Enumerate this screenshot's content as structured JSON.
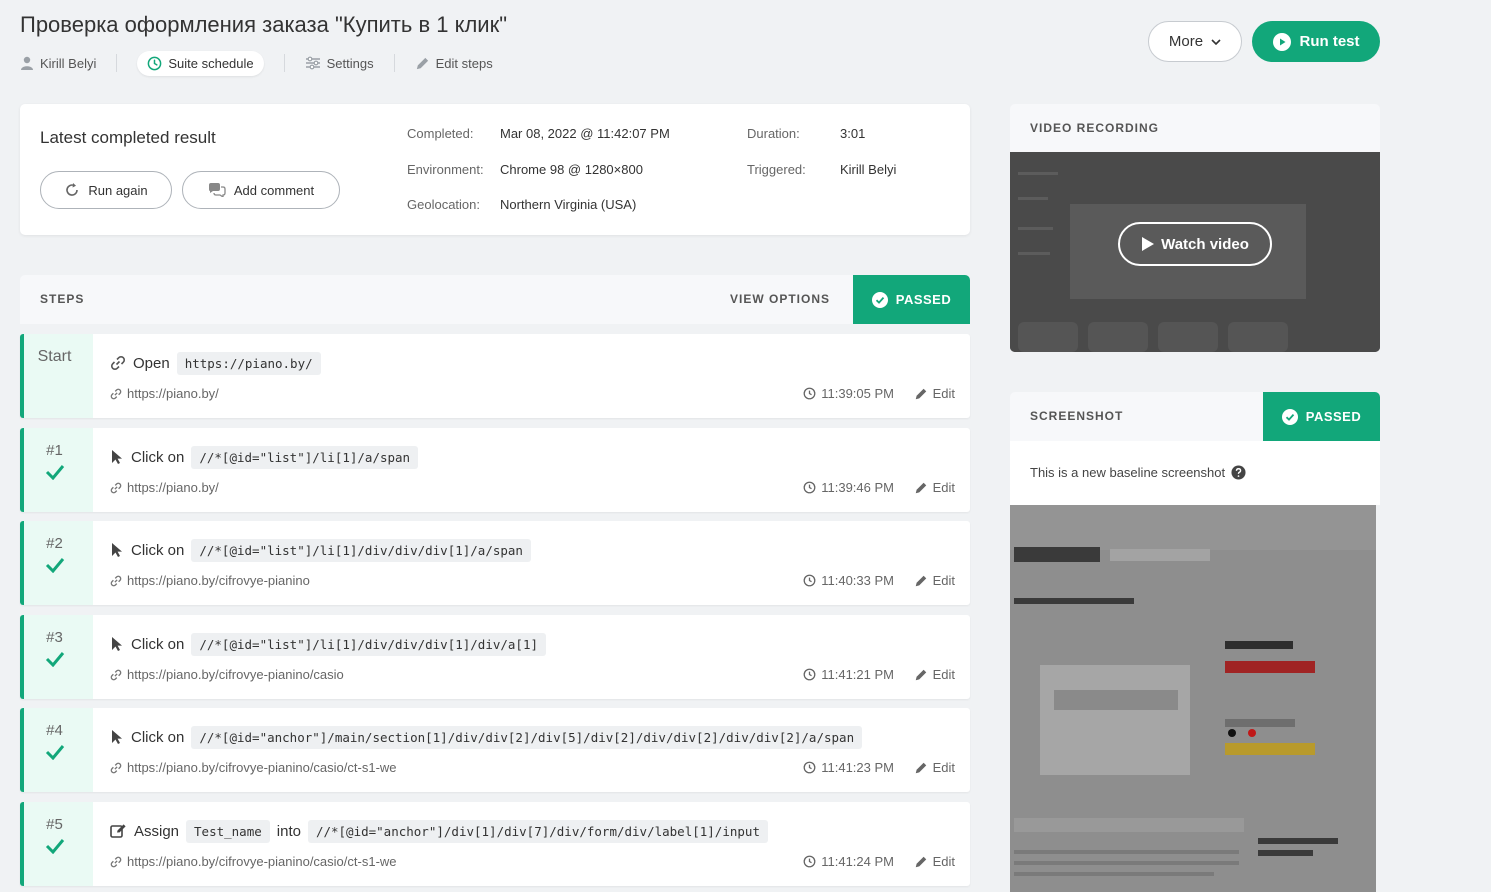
{
  "header": {
    "title": "Проверка оформления заказа \"Купить в 1 клик\"",
    "user": "Kirill Belyi",
    "suite_schedule": "Suite schedule",
    "settings": "Settings",
    "edit_steps": "Edit steps",
    "more": "More",
    "run_test": "Run test"
  },
  "latest": {
    "title": "Latest completed result",
    "run_again": "Run again",
    "add_comment": "Add comment",
    "completed_label": "Completed:",
    "completed_value": "Mar 08, 2022 @ 11:42:07 PM",
    "environment_label": "Environment:",
    "environment_value": "Chrome 98 @ 1280×800",
    "geolocation_label": "Geolocation:",
    "geolocation_value": "Northern Virginia (USA)",
    "duration_label": "Duration:",
    "duration_value": "3:01",
    "triggered_label": "Triggered:",
    "triggered_value": "Kirill Belyi"
  },
  "steps_panel": {
    "label": "STEPS",
    "view_options": "VIEW OPTIONS",
    "status": "PASSED"
  },
  "steps": [
    {
      "num": "Start",
      "action": "Open",
      "selector": "https://piano.by/",
      "url": "https://piano.by/",
      "time": "11:39:05 PM",
      "edit": "Edit"
    },
    {
      "num": "#1",
      "action": "Click on",
      "selector": "//*[@id=\"list\"]/li[1]/a/span",
      "url": "https://piano.by/",
      "time": "11:39:46 PM",
      "edit": "Edit"
    },
    {
      "num": "#2",
      "action": "Click on",
      "selector": "//*[@id=\"list\"]/li[1]/div/div/div[1]/a/span",
      "url": "https://piano.by/cifrovye-pianino",
      "time": "11:40:33 PM",
      "edit": "Edit"
    },
    {
      "num": "#3",
      "action": "Click on",
      "selector": "//*[@id=\"list\"]/li[1]/div/div/div[1]/div/a[1]",
      "url": "https://piano.by/cifrovye-pianino/casio",
      "time": "11:41:21 PM",
      "edit": "Edit"
    },
    {
      "num": "#4",
      "action": "Click on",
      "selector": "//*[@id=\"anchor\"]/main/section[1]/div/div[2]/div[5]/div[2]/div/div[2]/div/div[2]/a/span",
      "url": "https://piano.by/cifrovye-pianino/casio/ct-s1-we",
      "time": "11:41:23 PM",
      "edit": "Edit"
    },
    {
      "num": "#5",
      "action": "Assign",
      "value": "Test_name",
      "into": "into",
      "selector": "//*[@id=\"anchor\"]/div[1]/div[7]/div/form/div/label[1]/input",
      "url": "https://piano.by/cifrovye-pianino/casio/ct-s1-we",
      "time": "11:41:24 PM",
      "edit": "Edit"
    }
  ],
  "video": {
    "label": "VIDEO RECORDING",
    "watch": "Watch video"
  },
  "screenshot": {
    "label": "SCREENSHOT",
    "status": "PASSED",
    "note": "This is a new baseline screenshot"
  },
  "colors": {
    "accent": "#12a77a",
    "step_side_bg": "#eafaf4",
    "page_bg": "#f0f2f4"
  }
}
